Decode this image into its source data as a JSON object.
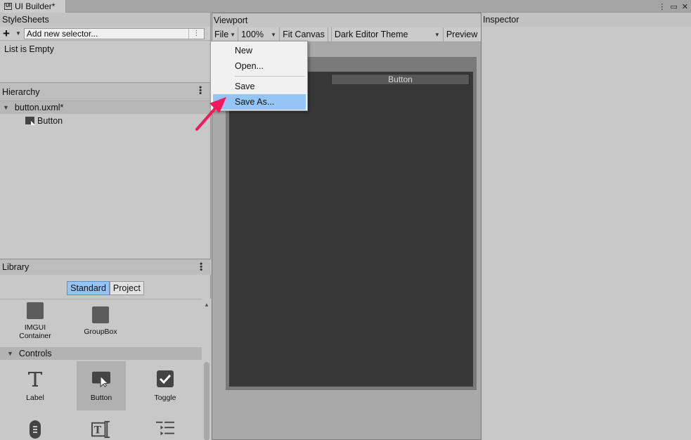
{
  "window": {
    "tab_title": "UI Builder*",
    "tab_icon": "UI",
    "controls": [
      "⋮",
      "▭",
      "✕"
    ]
  },
  "stylesheets": {
    "title": "StyleSheets",
    "add_icon": "+",
    "selector_placeholder": "Add new selector...",
    "selector_kebab": "⋮",
    "empty_text": "List is Empty"
  },
  "hierarchy": {
    "title": "Hierarchy",
    "root_label": "button.uxml*",
    "child_label": "Button"
  },
  "library": {
    "title": "Library",
    "tabs": [
      "Standard",
      "Project"
    ],
    "active_tab": "Standard",
    "top_items": [
      {
        "label": "IMGUI Container",
        "icon": "square-icon"
      },
      {
        "label": "GroupBox",
        "icon": "square-icon"
      }
    ],
    "section": "Controls",
    "controls": [
      {
        "label": "Label",
        "icon": "text-icon"
      },
      {
        "label": "Button",
        "icon": "button-icon",
        "selected": true
      },
      {
        "label": "Toggle",
        "icon": "checkbox-icon"
      }
    ]
  },
  "viewport": {
    "title": "Viewport",
    "file_label": "File",
    "zoom": "100%",
    "fit_canvas": "Fit Canvas",
    "theme": "Dark Editor Theme",
    "preview": "Preview",
    "canvas_button_text": "Button"
  },
  "file_menu": {
    "items": [
      "New",
      "Open...",
      "Save",
      "Save As..."
    ],
    "highlighted": "Save As..."
  },
  "inspector": {
    "title": "Inspector"
  },
  "colors": {
    "highlight": "#94c5f5",
    "arrow": "#f0195e",
    "canvas": "#383838"
  }
}
